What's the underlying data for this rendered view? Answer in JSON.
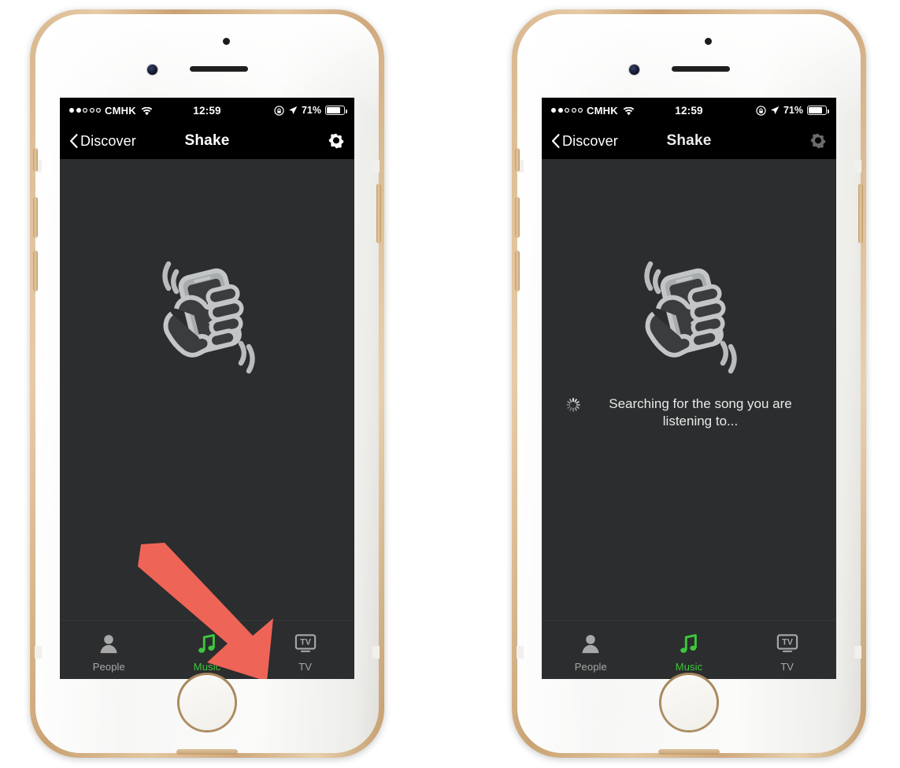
{
  "colors": {
    "screen_bg": "#2b2d2e",
    "bar_bg": "#000000",
    "accent_green": "#3dc83c",
    "annotation_red": "#ee6456",
    "tab_inactive": "#a8a8a8",
    "device_gold": "#d9b98f"
  },
  "status_bar": {
    "signal_filled_dots": 2,
    "signal_total_dots": 5,
    "carrier": "CMHK",
    "wifi_icon": "wifi-icon",
    "time": "12:59",
    "rotation_lock_icon": "rotation-lock-icon",
    "location_icon": "location-arrow-icon",
    "battery_percent": "71%",
    "battery_level": 71,
    "battery_icon": "battery-icon"
  },
  "nav_bar": {
    "back_icon": "chevron-left-icon",
    "back_label": "Discover",
    "title": "Shake",
    "settings_icon": "gear-icon"
  },
  "main": {
    "shake_icon": "shake-hand-phone-icon",
    "spinner_icon": "loading-spinner-icon",
    "searching_text": "Searching for the song you are listening to..."
  },
  "tabs": [
    {
      "id": "people",
      "label": "People",
      "icon": "person-icon",
      "active": false
    },
    {
      "id": "music",
      "label": "Music",
      "icon": "music-note-icon",
      "active": true
    },
    {
      "id": "tv",
      "label": "TV",
      "icon": "tv-icon",
      "active": false
    }
  ],
  "annotations": {
    "arrow_icon": "red-arrow-pointing-down-right",
    "highlight_icon": "red-circle-highlight",
    "target": "Music"
  },
  "devices": [
    {
      "id": "left",
      "state": "idle",
      "show_searching": false,
      "show_annotations": true,
      "gear_dim": false
    },
    {
      "id": "right",
      "state": "searching",
      "show_searching": true,
      "show_annotations": false,
      "gear_dim": true
    }
  ]
}
